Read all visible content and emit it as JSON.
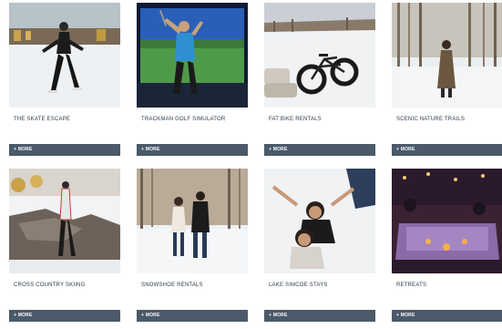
{
  "cards": [
    {
      "title": "THE SKATE ESCAPE",
      "button_label": "+ MORE",
      "image": "skater-on-ice-rink"
    },
    {
      "title": "TRACKMAN GOLF SIMULATOR",
      "button_label": "+ MORE",
      "image": "golfer-indoor-simulator"
    },
    {
      "title": "FAT BIKE RENTALS",
      "button_label": "+ MORE",
      "image": "fat-bike-in-snow"
    },
    {
      "title": "SCENIC NATURE TRAILS",
      "button_label": "+ MORE",
      "image": "woman-on-winter-trail"
    },
    {
      "title": "CROSS COUNTRY SKIING",
      "button_label": "+ MORE",
      "image": "skier-by-rocks"
    },
    {
      "title": "SNOWSHOE RENTALS",
      "button_label": "+ MORE",
      "image": "couple-snowshoeing"
    },
    {
      "title": "LAKE SIMCOE STAYS",
      "button_label": "+ MORE",
      "image": "couple-lying-on-snow"
    },
    {
      "title": "RETREATS",
      "button_label": "+ MORE",
      "image": "group-dining-event"
    }
  ]
}
